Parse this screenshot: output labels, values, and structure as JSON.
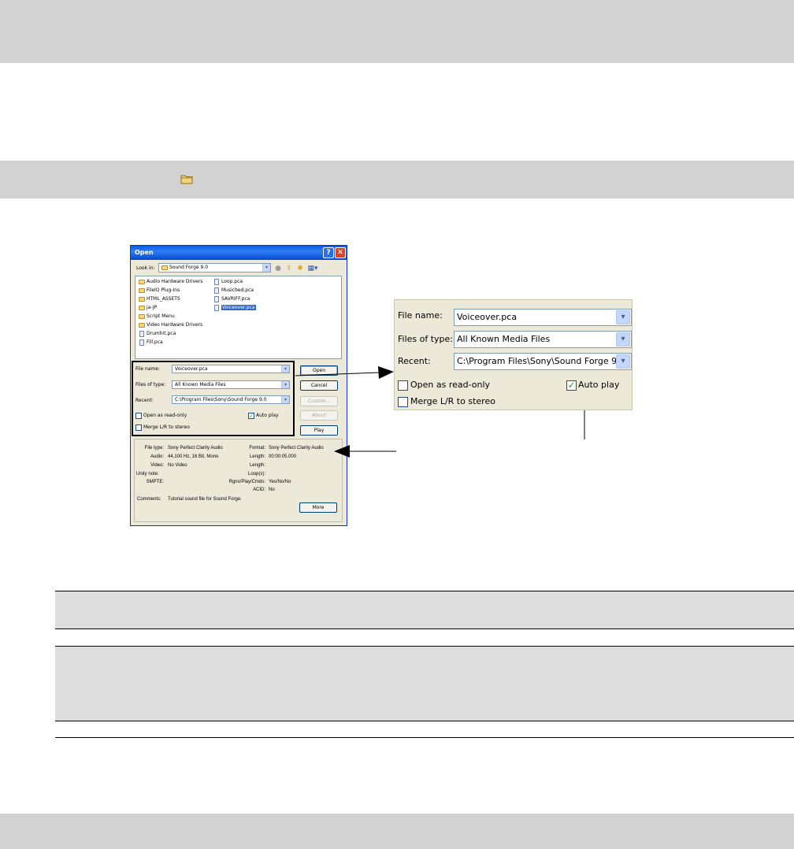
{
  "dialog": {
    "title": "Open",
    "help_button": "?",
    "close_button": "✕",
    "look_in_label": "Look in:",
    "look_in_value": "Sound Forge 9.0",
    "files": [
      {
        "name": "Audio Hardware Drivers",
        "kind": "folder",
        "col": 0,
        "row": 0
      },
      {
        "name": "FileIO Plug-Ins",
        "kind": "folder",
        "col": 0,
        "row": 1
      },
      {
        "name": "HTML_ASSETS",
        "kind": "folder",
        "col": 0,
        "row": 2
      },
      {
        "name": "ja-JP",
        "kind": "folder",
        "col": 0,
        "row": 3
      },
      {
        "name": "Script Menu",
        "kind": "folder",
        "col": 0,
        "row": 4
      },
      {
        "name": "Video Hardware Drivers",
        "kind": "folder",
        "col": 0,
        "row": 5
      },
      {
        "name": "Drumhit.pca",
        "kind": "file",
        "col": 0,
        "row": 6
      },
      {
        "name": "Fill.pca",
        "kind": "file",
        "col": 0,
        "row": 7
      },
      {
        "name": "Loop.pca",
        "kind": "file",
        "col": 1,
        "row": 0
      },
      {
        "name": "Musicbed.pca",
        "kind": "file",
        "col": 1,
        "row": 1
      },
      {
        "name": "SAVRIFF.pca",
        "kind": "file",
        "col": 1,
        "row": 2
      },
      {
        "name": "Voiceover.pca",
        "kind": "file",
        "col": 1,
        "row": 3,
        "selected": true
      }
    ],
    "file_name_label": "File name:",
    "file_name_value": "Voiceover.pca",
    "files_of_type_label": "Files of type:",
    "files_of_type_value": "All Known Media Files",
    "recent_label": "Recent:",
    "recent_value": "C:\\Program Files\\Sony\\Sound Forge 9.0",
    "open_readonly_label": "Open as read-only",
    "open_readonly_checked": false,
    "auto_play_label": "Auto play",
    "auto_play_checked": true,
    "merge_label": "Merge L/R to stereo",
    "merge_checked": false,
    "buttons": {
      "open": "Open",
      "cancel": "Cancel",
      "custom": "Custom...",
      "about": "About",
      "play": "Play",
      "more": "More"
    },
    "info": {
      "file_type_label": "File type:",
      "file_type_value": "Sony Perfect Clarity Audio",
      "audio_label": "Audio:",
      "audio_value": "44,100 Hz, 16 Bit, Mono",
      "video_label": "Video:",
      "video_value": "No Video",
      "unity_label": "Unity note:",
      "smpte_label": "SMPTE:",
      "comments_label": "Comments:",
      "comments_value": "Tutorial sound file for Sound Forge.",
      "format_label": "Format:",
      "format_value": "Sony Perfect Clarity Audio",
      "length_label": "Length:",
      "length_value": "00:00:05.000",
      "length2_label": "Length:",
      "loops_label": "Loop(s):",
      "rgns_label": "Rgns/Play/Cmds:",
      "rgns_value": "Yes/No/No",
      "acid_label": "ACID:",
      "acid_value": "No"
    }
  },
  "zoom": {
    "file_name_label": "File name:",
    "file_name_value": "Voiceover.pca",
    "files_of_type_label": "Files of type:",
    "files_of_type_value": "All Known Media Files",
    "recent_label": "Recent:",
    "recent_value": "C:\\Program Files\\Sony\\Sound Forge 9.0",
    "open_readonly_label": "Open as read-only",
    "auto_play_label": "Auto play",
    "merge_label": "Merge L/R to stereo"
  },
  "colors": {
    "band": "#d2d2d2",
    "dialog_face": "#ece9d8",
    "titlebar": "#0a5ce6",
    "selection": "#316ac5"
  }
}
